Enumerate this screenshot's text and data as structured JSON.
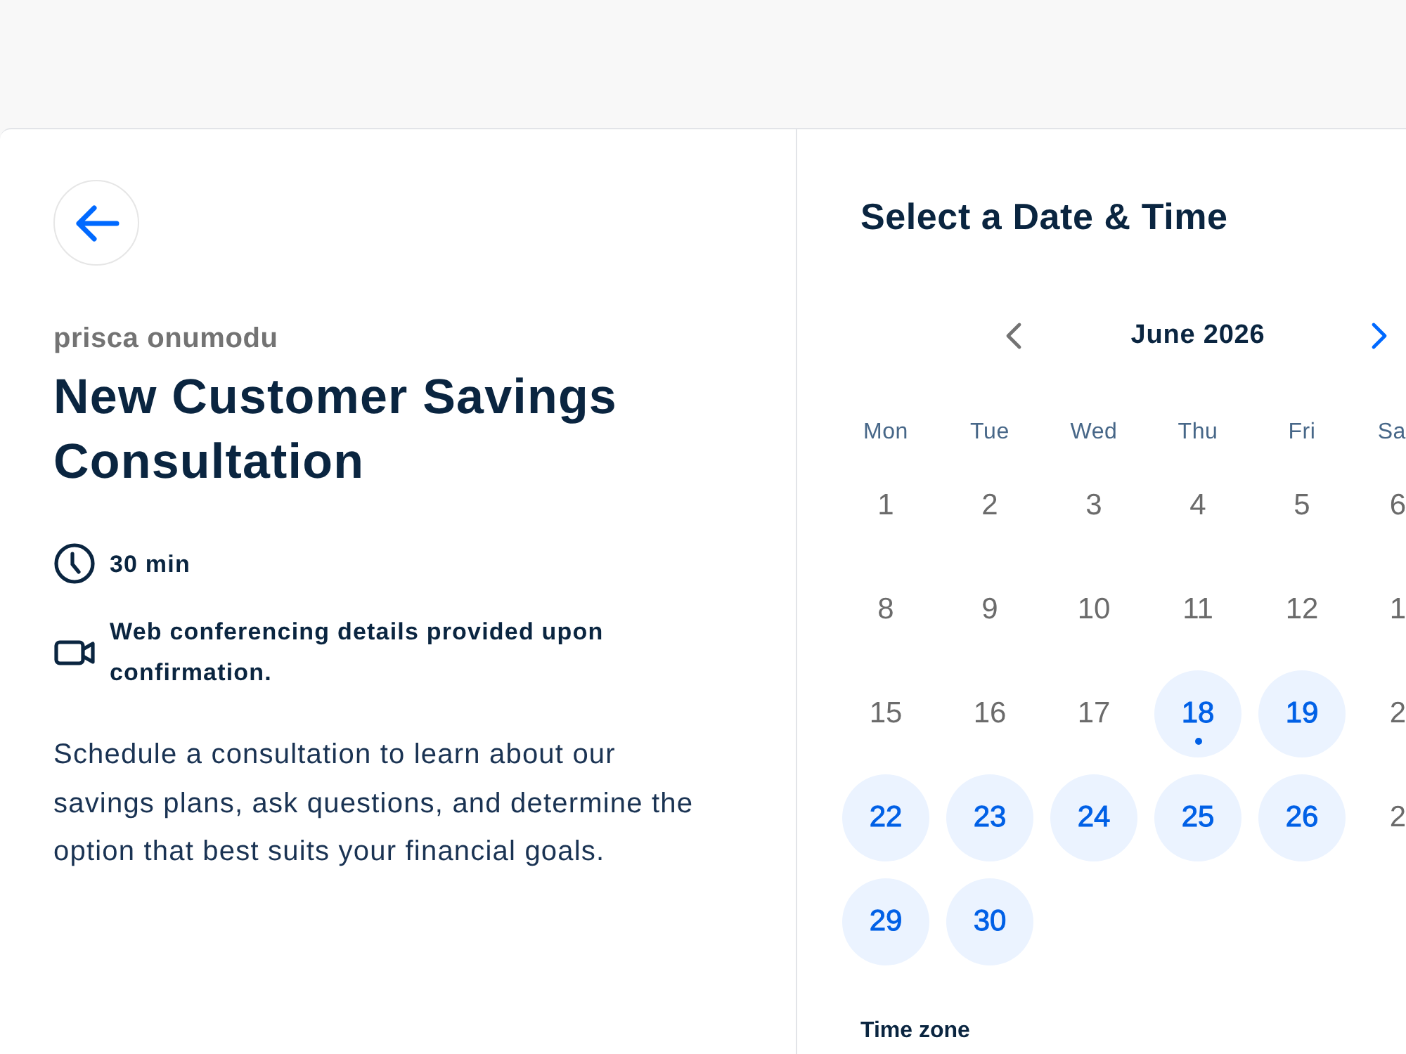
{
  "event": {
    "organizer": "prisca onumodu",
    "title": "New Customer Savings Consultation",
    "details": [
      {
        "kind": "duration",
        "text": "30 min"
      },
      {
        "kind": "video",
        "text": "Web conferencing details provided upon confirmation."
      }
    ],
    "description": "Schedule a consultation to learn about our savings plans, ask questions, and determine the option that best suits your financial goals."
  },
  "scheduler": {
    "heading": "Select a Date & Time",
    "month": "June 2026",
    "prev_month": {
      "disabled": true
    },
    "next_month": {
      "disabled": false
    },
    "weekdays": [
      "Mon",
      "Tue",
      "Wed",
      "Thu",
      "Fri",
      "Sa"
    ],
    "weeks": [
      [
        {
          "label": "1",
          "available": false,
          "today": false
        },
        {
          "label": "2",
          "available": false,
          "today": false
        },
        {
          "label": "3",
          "available": false,
          "today": false
        },
        {
          "label": "4",
          "available": false,
          "today": false
        },
        {
          "label": "5",
          "available": false,
          "today": false
        },
        {
          "label": "6",
          "available": false,
          "today": false
        }
      ],
      [
        {
          "label": "8",
          "available": false,
          "today": false
        },
        {
          "label": "9",
          "available": false,
          "today": false
        },
        {
          "label": "10",
          "available": false,
          "today": false
        },
        {
          "label": "11",
          "available": false,
          "today": false
        },
        {
          "label": "12",
          "available": false,
          "today": false
        },
        {
          "label": "1",
          "available": false,
          "today": false
        }
      ],
      [
        {
          "label": "15",
          "available": false,
          "today": false
        },
        {
          "label": "16",
          "available": false,
          "today": false
        },
        {
          "label": "17",
          "available": false,
          "today": false
        },
        {
          "label": "18",
          "available": true,
          "today": true
        },
        {
          "label": "19",
          "available": true,
          "today": false
        },
        {
          "label": "2",
          "available": false,
          "today": false
        }
      ],
      [
        {
          "label": "22",
          "available": true,
          "today": false
        },
        {
          "label": "23",
          "available": true,
          "today": false
        },
        {
          "label": "24",
          "available": true,
          "today": false
        },
        {
          "label": "25",
          "available": true,
          "today": false
        },
        {
          "label": "26",
          "available": true,
          "today": false
        },
        {
          "label": "2",
          "available": false,
          "today": false
        }
      ],
      [
        {
          "label": "29",
          "available": true,
          "today": false
        },
        {
          "label": "30",
          "available": true,
          "today": false
        }
      ]
    ],
    "time_zone": {
      "label": "Time zone"
    }
  }
}
